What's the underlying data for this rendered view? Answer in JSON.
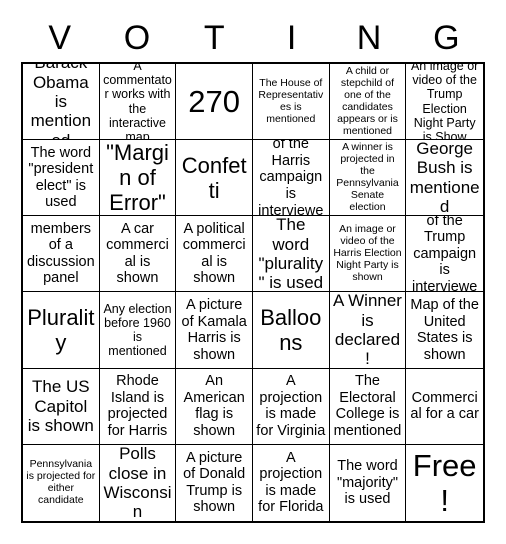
{
  "header": {
    "letters": [
      "V",
      "O",
      "T",
      "I",
      "N",
      "G"
    ],
    "title": "VOTING"
  },
  "grid": {
    "columns": 6,
    "rows": 6,
    "border_color": "#000000",
    "background_color": "#ffffff"
  },
  "cells": [
    {
      "text": "Barack Obama is mentioned",
      "size": "fs-lg"
    },
    {
      "text": "A commentator works with the interactive map",
      "size": "fs-sm"
    },
    {
      "text": "270",
      "size": "fs-xxl"
    },
    {
      "text": "The House of Representatives is mentioned",
      "size": "fs-xs"
    },
    {
      "text": "A child or stepchild of one of the candidates appears or is mentioned",
      "size": "fs-xs"
    },
    {
      "text": "An image or video of the Trump Election Night Party is Show",
      "size": "fs-sm"
    },
    {
      "text": "The word \"president elect\" is used",
      "size": "fs-md"
    },
    {
      "text": "\"Margin of Error\"",
      "size": "fs-xl"
    },
    {
      "text": "Confetti",
      "size": "fs-xl"
    },
    {
      "text": "A member of the Harris campaign is interviewed",
      "size": "fs-md"
    },
    {
      "text": "A winner is projected in the Pennsylvania Senate election",
      "size": "fs-xs"
    },
    {
      "text": "George Bush is mentioned",
      "size": "fs-lg"
    },
    {
      "text": "Two members of a discussion panel argue",
      "size": "fs-md"
    },
    {
      "text": "A car commercial is shown",
      "size": "fs-md"
    },
    {
      "text": "A political commercial is shown",
      "size": "fs-md"
    },
    {
      "text": "The word \"plurality\" is used",
      "size": "fs-lg"
    },
    {
      "text": "An image or video of the Harris Election Night Party is shown",
      "size": "fs-xs"
    },
    {
      "text": "A member of the Trump campaign is interviewed",
      "size": "fs-md"
    },
    {
      "text": "Plurality",
      "size": "fs-xl"
    },
    {
      "text": "Any election before 1960 is mentioned",
      "size": "fs-sm"
    },
    {
      "text": "A picture of Kamala Harris is shown",
      "size": "fs-md"
    },
    {
      "text": "Balloons",
      "size": "fs-xl"
    },
    {
      "text": "A Winner is declared!",
      "size": "fs-lg"
    },
    {
      "text": "Map of the United States is shown",
      "size": "fs-md"
    },
    {
      "text": "The US Capitol is shown",
      "size": "fs-lg"
    },
    {
      "text": "Rhode Island is projected for Harris",
      "size": "fs-md"
    },
    {
      "text": "An American flag is shown",
      "size": "fs-md"
    },
    {
      "text": "A projection is made for Virginia",
      "size": "fs-md"
    },
    {
      "text": "The Electoral College is mentioned",
      "size": "fs-md"
    },
    {
      "text": "Commercial for a car",
      "size": "fs-md"
    },
    {
      "text": "Pennsylvania is projected for either candidate",
      "size": "fs-xs"
    },
    {
      "text": "Polls close in Wisconsin",
      "size": "fs-lg"
    },
    {
      "text": "A picture of Donald Trump is shown",
      "size": "fs-md"
    },
    {
      "text": "A projection is made for Florida",
      "size": "fs-md"
    },
    {
      "text": "The word \"majority\" is used",
      "size": "fs-md"
    },
    {
      "text": "Free!",
      "size": "fs-xxl"
    }
  ]
}
